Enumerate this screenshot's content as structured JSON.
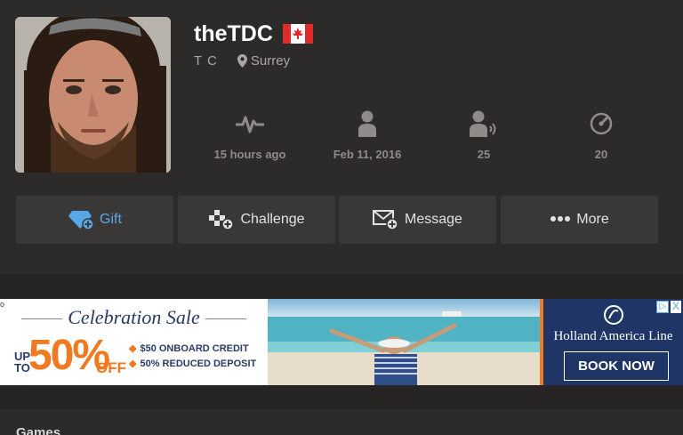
{
  "profile": {
    "username": "theTDC",
    "flag_country": "Canada",
    "real_name": "T C",
    "location": "Surrey"
  },
  "stats": [
    {
      "icon": "activity-pulse-icon",
      "value": "15 hours ago"
    },
    {
      "icon": "person-icon",
      "value": "Feb 11, 2016"
    },
    {
      "icon": "person-speaking-icon",
      "value": "25"
    },
    {
      "icon": "speedometer-icon",
      "value": "20"
    }
  ],
  "actions": {
    "gift": "Gift",
    "challenge": "Challenge",
    "message": "Message",
    "more": "More"
  },
  "ad": {
    "marker": "o",
    "title": "Celebration Sale",
    "up_to": "UP TO",
    "percent": "50%",
    "off": "OFF",
    "point1": "$50 ONBOARD CREDIT",
    "point2": "50% REDUCED DEPOSIT",
    "brand": "Holland America Line",
    "cta": "BOOK NOW",
    "choices": "▷",
    "close": "X"
  },
  "sections": {
    "games_title": "Games"
  },
  "colors": {
    "page_bg": "#272524",
    "panel_bg": "#2d2b29",
    "button_bg": "#3a3836",
    "gift_accent": "#58a8e8",
    "ad_orange": "#f07a22",
    "ad_navy": "#1e3566"
  }
}
